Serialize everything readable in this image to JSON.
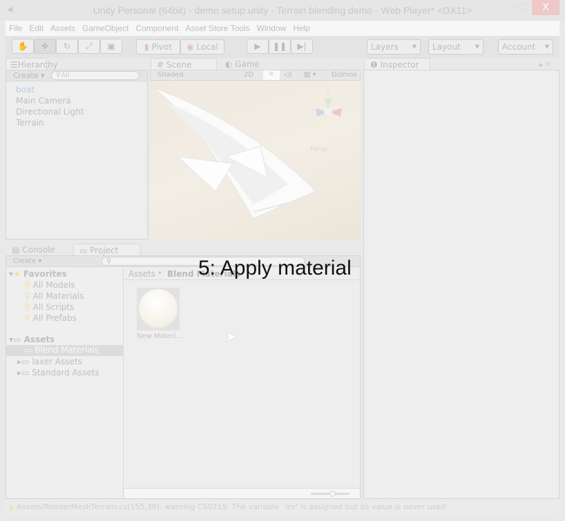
{
  "window": {
    "title": "Unity Personal (64bit) - demo setup.unity - Terrain blending demo - Web Player* <DX11>",
    "close": "X"
  },
  "menu": [
    "File",
    "Edit",
    "Assets",
    "GameObject",
    "Component",
    "Asset Store Tools",
    "Window",
    "Help"
  ],
  "toolbar": {
    "pivot": "Pivot",
    "local": "Local",
    "layers": "Layers",
    "layout": "Layout",
    "account": "Account"
  },
  "hierarchy": {
    "tab": "Hierarchy",
    "create": "Create",
    "search_placeholder": "All",
    "items": [
      "boat",
      "Main Camera",
      "Directional Light",
      "Terrain"
    ]
  },
  "scene": {
    "tab_scene": "Scene",
    "tab_game": "Game",
    "shading": "Shaded",
    "mode_2d": "2D",
    "gizmos": "Gizmos",
    "persp": "Persp"
  },
  "inspector": {
    "tab": "Inspector"
  },
  "project": {
    "tab_console": "Console",
    "tab_project": "Project",
    "create": "Create",
    "favorites": {
      "label": "Favorites",
      "items": [
        "All Models",
        "All Materials",
        "All Scripts",
        "All Prefabs"
      ]
    },
    "assets": {
      "label": "Assets",
      "items": [
        "Blend Materials",
        "laxer Assets",
        "Standard Assets"
      ]
    },
    "breadcrumb": [
      "Assets",
      "Blend Materials"
    ],
    "files": [
      {
        "name": "New Materi..."
      }
    ]
  },
  "overlay": "5: Apply material",
  "status": "Assets/RenderMeshTerrain.cs(155,38): warning CS0219: The variable `mr' is assigned but its value is never used"
}
